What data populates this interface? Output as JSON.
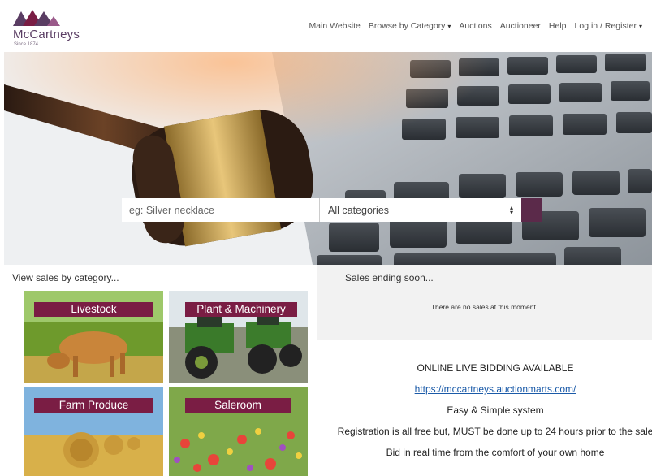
{
  "brand": {
    "name": "McCartneys",
    "since": "Since 1874",
    "accent": "#7a1d44",
    "logo_color": "#5a3d63"
  },
  "nav": {
    "items": [
      {
        "label": "Main Website",
        "dropdown": false
      },
      {
        "label": "Browse by Category",
        "dropdown": true
      },
      {
        "label": "Auctions",
        "dropdown": false
      },
      {
        "label": "Auctioneer",
        "dropdown": false
      },
      {
        "label": "Help",
        "dropdown": false
      },
      {
        "label": "Log in / Register",
        "dropdown": true
      }
    ]
  },
  "search": {
    "placeholder": "eg: Silver necklace",
    "category_selected": "All categories",
    "button_icon": "search-icon"
  },
  "categories": {
    "heading": "View sales by category...",
    "tiles": [
      {
        "label": "Livestock"
      },
      {
        "label": "Plant & Machinery"
      },
      {
        "label": "Farm Produce"
      },
      {
        "label": "Saleroom"
      }
    ]
  },
  "sales": {
    "heading": "Sales ending soon...",
    "empty_message": "There are no sales at this moment."
  },
  "live_bidding": {
    "title": "ONLINE LIVE BIDDING AVAILABLE",
    "link": "https://mccartneys.auctionmarts.com/",
    "line1": "Easy & Simple system",
    "line2": "Registration is all free but, MUST be done up to 24 hours prior to the sale",
    "line3": "Bid in real time from the comfort of your own home"
  }
}
